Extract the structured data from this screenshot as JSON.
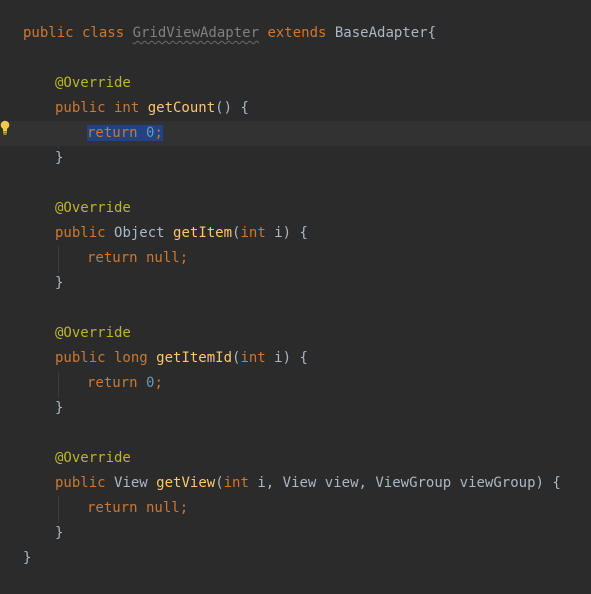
{
  "editor": {
    "lines": [
      {
        "tokens": [
          {
            "t": "public class ",
            "c": "kw"
          },
          {
            "t": "GridViewAdapter",
            "c": "unused"
          },
          {
            "t": " extends ",
            "c": "kw"
          },
          {
            "t": "BaseAdapter{",
            "c": "txt"
          }
        ]
      },
      {
        "tokens": []
      },
      {
        "tokens": [
          {
            "t": "@Override",
            "c": "ann"
          }
        ]
      },
      {
        "tokens": [
          {
            "t": "public int ",
            "c": "kw"
          },
          {
            "t": "getCount",
            "c": "fn"
          },
          {
            "t": "() {",
            "c": "txt"
          }
        ]
      },
      {
        "tokens": [
          {
            "t": "return ",
            "c": "kw",
            "sel": true
          },
          {
            "t": "0",
            "c": "num",
            "sel": true
          },
          {
            "t": ";",
            "c": "kw",
            "sel": true
          }
        ]
      },
      {
        "tokens": [
          {
            "t": "}",
            "c": "txt"
          }
        ]
      },
      {
        "tokens": []
      },
      {
        "tokens": [
          {
            "t": "@Override",
            "c": "ann"
          }
        ]
      },
      {
        "tokens": [
          {
            "t": "public ",
            "c": "kw"
          },
          {
            "t": "Object ",
            "c": "txt"
          },
          {
            "t": "getItem",
            "c": "fn"
          },
          {
            "t": "(",
            "c": "txt"
          },
          {
            "t": "int ",
            "c": "kw"
          },
          {
            "t": "i) {",
            "c": "txt"
          }
        ]
      },
      {
        "tokens": [
          {
            "t": "return null;",
            "c": "kw"
          }
        ]
      },
      {
        "tokens": [
          {
            "t": "}",
            "c": "txt"
          }
        ]
      },
      {
        "tokens": []
      },
      {
        "tokens": [
          {
            "t": "@Override",
            "c": "ann"
          }
        ]
      },
      {
        "tokens": [
          {
            "t": "public long ",
            "c": "kw"
          },
          {
            "t": "getItemId",
            "c": "fn"
          },
          {
            "t": "(",
            "c": "txt"
          },
          {
            "t": "int ",
            "c": "kw"
          },
          {
            "t": "i) {",
            "c": "txt"
          }
        ]
      },
      {
        "tokens": [
          {
            "t": "return ",
            "c": "kw"
          },
          {
            "t": "0",
            "c": "num"
          },
          {
            "t": ";",
            "c": "kw"
          }
        ]
      },
      {
        "tokens": [
          {
            "t": "}",
            "c": "txt"
          }
        ]
      },
      {
        "tokens": []
      },
      {
        "tokens": [
          {
            "t": "@Override",
            "c": "ann"
          }
        ]
      },
      {
        "tokens": [
          {
            "t": "public ",
            "c": "kw"
          },
          {
            "t": "View ",
            "c": "txt"
          },
          {
            "t": "getView",
            "c": "fn"
          },
          {
            "t": "(",
            "c": "txt"
          },
          {
            "t": "int ",
            "c": "kw"
          },
          {
            "t": "i, ",
            "c": "txt"
          },
          {
            "t": "View view, ViewGroup viewGroup) {",
            "c": "txt"
          }
        ]
      },
      {
        "tokens": [
          {
            "t": "return null;",
            "c": "kw"
          }
        ]
      },
      {
        "tokens": [
          {
            "t": "}",
            "c": "txt"
          }
        ]
      },
      {
        "tokens": [
          {
            "t": "}",
            "c": "txt"
          }
        ]
      }
    ]
  },
  "intention_icon": "lightbulb-icon"
}
